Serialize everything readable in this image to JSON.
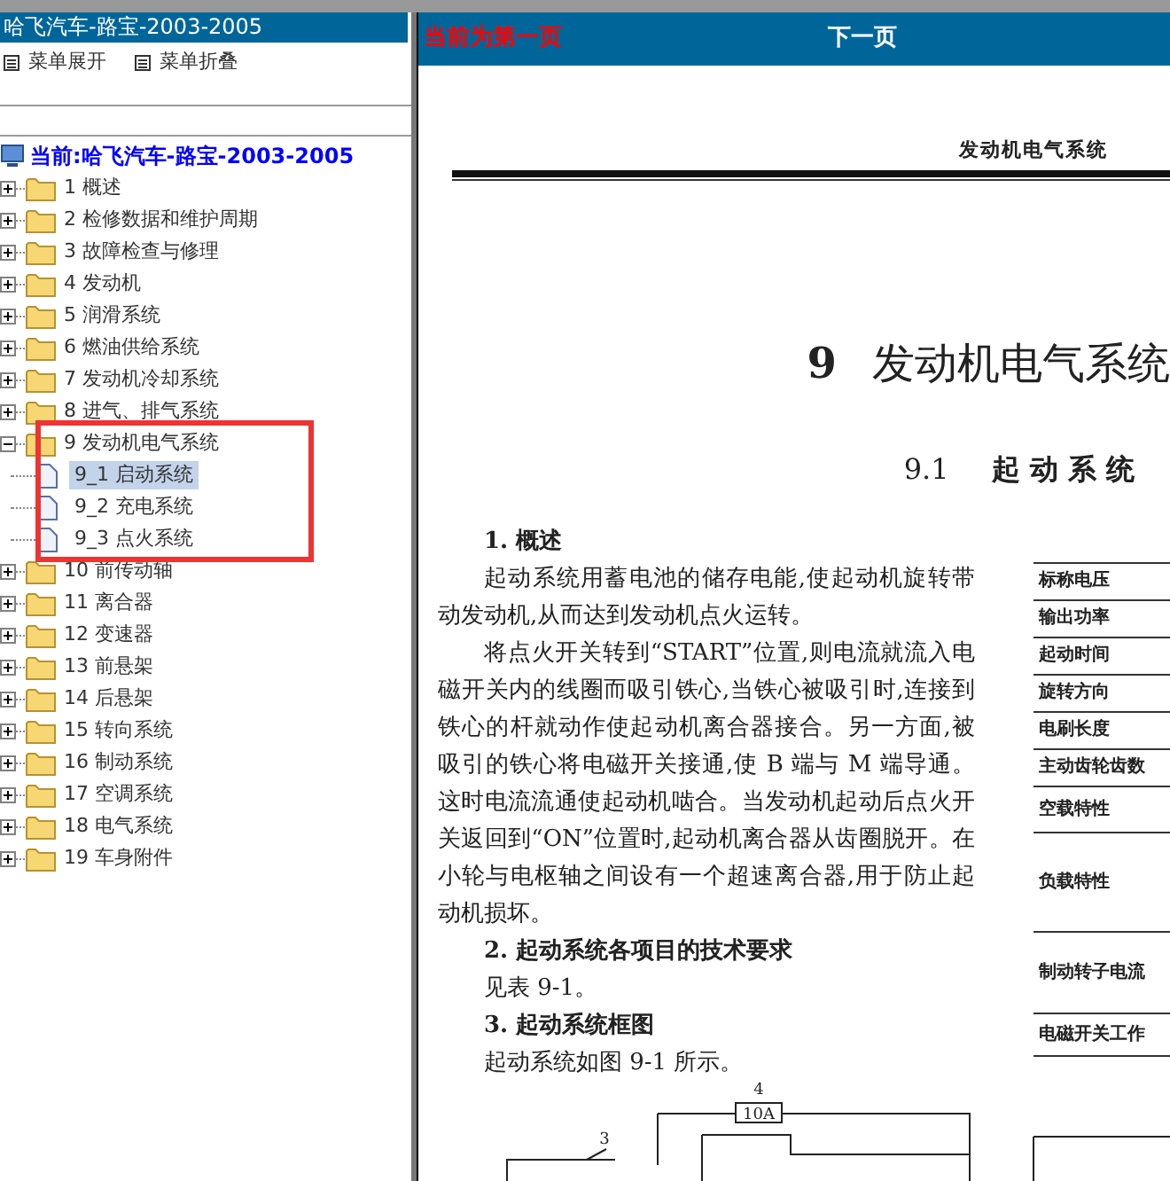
{
  "left_pane": {
    "title": "哈飞汽车-路宝-2003-2005",
    "toolbar": [
      {
        "label": "菜单展开"
      },
      {
        "label": "菜单折叠"
      }
    ],
    "tree": {
      "root": "当前:哈飞汽车-路宝-2003-2005",
      "items": [
        {
          "label": "1 概述",
          "expanded": false
        },
        {
          "label": "2 检修数据和维护周期",
          "expanded": false
        },
        {
          "label": "3 故障检查与修理",
          "expanded": false
        },
        {
          "label": "4 发动机",
          "expanded": false
        },
        {
          "label": "5 润滑系统",
          "expanded": false
        },
        {
          "label": "6 燃油供给系统",
          "expanded": false
        },
        {
          "label": "7 发动机冷却系统",
          "expanded": false
        },
        {
          "label": "8 进气、排气系统",
          "expanded": false
        },
        {
          "label": "9 发动机电气系统",
          "expanded": true,
          "children": [
            {
              "label": "9_1 启动系统",
              "selected": true
            },
            {
              "label": "9_2 充电系统",
              "selected": false
            },
            {
              "label": "9_3 点火系统",
              "selected": false
            }
          ]
        },
        {
          "label": "10 前传动轴",
          "expanded": false
        },
        {
          "label": "11 离合器",
          "expanded": false
        },
        {
          "label": "12 变速器",
          "expanded": false
        },
        {
          "label": "13 前悬架",
          "expanded": false
        },
        {
          "label": "14 后悬架",
          "expanded": false
        },
        {
          "label": "15 转向系统",
          "expanded": false
        },
        {
          "label": "16 制动系统",
          "expanded": false
        },
        {
          "label": "17 空调系统",
          "expanded": false
        },
        {
          "label": "18 电气系统",
          "expanded": false
        },
        {
          "label": "19 车身附件",
          "expanded": false
        }
      ]
    }
  },
  "viewer": {
    "page_status": "当前为第一页",
    "next_button": "下一页",
    "page": {
      "running_head": "发动机电气系统",
      "chapter_number": "9",
      "chapter_title": "发动机电气系统",
      "section_number": "9.1",
      "section_title": "起 动 系 统",
      "blocks": [
        {
          "kind": "heading",
          "text": "1. 概述"
        },
        {
          "kind": "paragraph",
          "text": "起动系统用蓄电池的储存电能,使起动机旋转带动发动机,从而达到发动机点火运转。"
        },
        {
          "kind": "paragraph",
          "text": "将点火开关转到“START”位置,则电流就流入电磁开关内的线圈而吸引铁心,当铁心被吸引时,连接到铁心的杆就动作使起动机离合器接合。另一方面,被吸引的铁心将电磁开关接通,使 B 端与 M 端导通。这时电流流通使起动机啮合。当发动机起动后点火开关返回到“ON”位置时,起动机离合器从齿圈脱开。在小轮与电枢轴之间设有一个超速离合器,用于防止起动机损坏。"
        },
        {
          "kind": "heading",
          "text": "2. 起动系统各项目的技术要求"
        },
        {
          "kind": "line",
          "text": "见表 9-1。"
        },
        {
          "kind": "heading",
          "text": "3. 起动系统框图"
        },
        {
          "kind": "line",
          "text": "起动系统如图 9-1 所示。"
        }
      ],
      "table_rows": [
        "标称电压",
        "输出功率",
        "起动时间",
        "旋转方向",
        "电刷长度",
        "主动齿轮齿数",
        "空载特性",
        "负载特性",
        "制动转子电流",
        "电磁开关工作"
      ],
      "diagram_labels": [
        "4",
        "10A",
        "3"
      ]
    }
  }
}
